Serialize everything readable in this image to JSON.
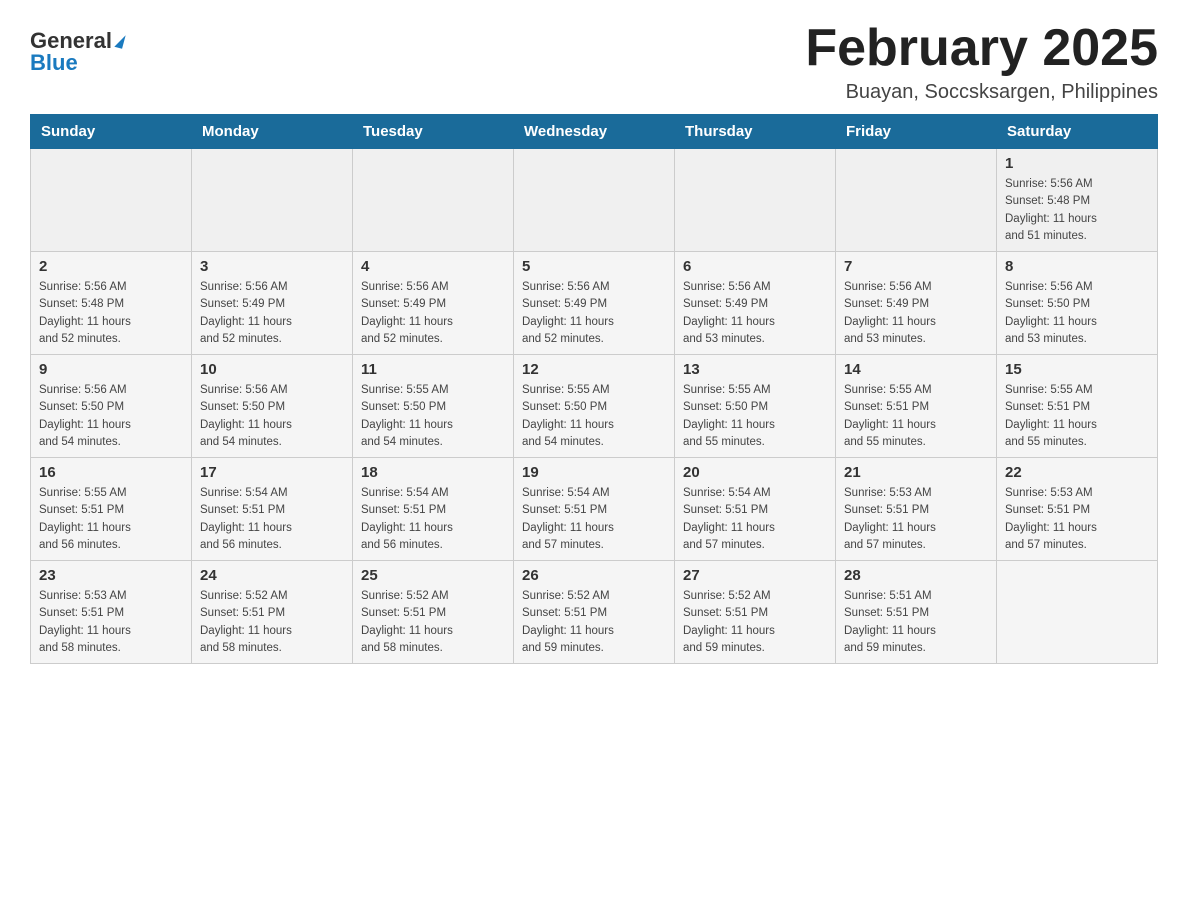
{
  "logo": {
    "general": "General",
    "blue": "Blue",
    "triangle": "▲"
  },
  "title": {
    "month_year": "February 2025",
    "location": "Buayan, Soccsksargen, Philippines"
  },
  "days_of_week": [
    "Sunday",
    "Monday",
    "Tuesday",
    "Wednesday",
    "Thursday",
    "Friday",
    "Saturday"
  ],
  "weeks": [
    {
      "row_class": "top-row",
      "days": [
        {
          "num": "",
          "info": ""
        },
        {
          "num": "",
          "info": ""
        },
        {
          "num": "",
          "info": ""
        },
        {
          "num": "",
          "info": ""
        },
        {
          "num": "",
          "info": ""
        },
        {
          "num": "",
          "info": ""
        },
        {
          "num": "1",
          "info": "Sunrise: 5:56 AM\nSunset: 5:48 PM\nDaylight: 11 hours\nand 51 minutes."
        }
      ]
    },
    {
      "row_class": "row-odd",
      "days": [
        {
          "num": "2",
          "info": "Sunrise: 5:56 AM\nSunset: 5:48 PM\nDaylight: 11 hours\nand 52 minutes."
        },
        {
          "num": "3",
          "info": "Sunrise: 5:56 AM\nSunset: 5:49 PM\nDaylight: 11 hours\nand 52 minutes."
        },
        {
          "num": "4",
          "info": "Sunrise: 5:56 AM\nSunset: 5:49 PM\nDaylight: 11 hours\nand 52 minutes."
        },
        {
          "num": "5",
          "info": "Sunrise: 5:56 AM\nSunset: 5:49 PM\nDaylight: 11 hours\nand 52 minutes."
        },
        {
          "num": "6",
          "info": "Sunrise: 5:56 AM\nSunset: 5:49 PM\nDaylight: 11 hours\nand 53 minutes."
        },
        {
          "num": "7",
          "info": "Sunrise: 5:56 AM\nSunset: 5:49 PM\nDaylight: 11 hours\nand 53 minutes."
        },
        {
          "num": "8",
          "info": "Sunrise: 5:56 AM\nSunset: 5:50 PM\nDaylight: 11 hours\nand 53 minutes."
        }
      ]
    },
    {
      "row_class": "row-even",
      "days": [
        {
          "num": "9",
          "info": "Sunrise: 5:56 AM\nSunset: 5:50 PM\nDaylight: 11 hours\nand 54 minutes."
        },
        {
          "num": "10",
          "info": "Sunrise: 5:56 AM\nSunset: 5:50 PM\nDaylight: 11 hours\nand 54 minutes."
        },
        {
          "num": "11",
          "info": "Sunrise: 5:55 AM\nSunset: 5:50 PM\nDaylight: 11 hours\nand 54 minutes."
        },
        {
          "num": "12",
          "info": "Sunrise: 5:55 AM\nSunset: 5:50 PM\nDaylight: 11 hours\nand 54 minutes."
        },
        {
          "num": "13",
          "info": "Sunrise: 5:55 AM\nSunset: 5:50 PM\nDaylight: 11 hours\nand 55 minutes."
        },
        {
          "num": "14",
          "info": "Sunrise: 5:55 AM\nSunset: 5:51 PM\nDaylight: 11 hours\nand 55 minutes."
        },
        {
          "num": "15",
          "info": "Sunrise: 5:55 AM\nSunset: 5:51 PM\nDaylight: 11 hours\nand 55 minutes."
        }
      ]
    },
    {
      "row_class": "row-odd",
      "days": [
        {
          "num": "16",
          "info": "Sunrise: 5:55 AM\nSunset: 5:51 PM\nDaylight: 11 hours\nand 56 minutes."
        },
        {
          "num": "17",
          "info": "Sunrise: 5:54 AM\nSunset: 5:51 PM\nDaylight: 11 hours\nand 56 minutes."
        },
        {
          "num": "18",
          "info": "Sunrise: 5:54 AM\nSunset: 5:51 PM\nDaylight: 11 hours\nand 56 minutes."
        },
        {
          "num": "19",
          "info": "Sunrise: 5:54 AM\nSunset: 5:51 PM\nDaylight: 11 hours\nand 57 minutes."
        },
        {
          "num": "20",
          "info": "Sunrise: 5:54 AM\nSunset: 5:51 PM\nDaylight: 11 hours\nand 57 minutes."
        },
        {
          "num": "21",
          "info": "Sunrise: 5:53 AM\nSunset: 5:51 PM\nDaylight: 11 hours\nand 57 minutes."
        },
        {
          "num": "22",
          "info": "Sunrise: 5:53 AM\nSunset: 5:51 PM\nDaylight: 11 hours\nand 57 minutes."
        }
      ]
    },
    {
      "row_class": "row-even",
      "days": [
        {
          "num": "23",
          "info": "Sunrise: 5:53 AM\nSunset: 5:51 PM\nDaylight: 11 hours\nand 58 minutes."
        },
        {
          "num": "24",
          "info": "Sunrise: 5:52 AM\nSunset: 5:51 PM\nDaylight: 11 hours\nand 58 minutes."
        },
        {
          "num": "25",
          "info": "Sunrise: 5:52 AM\nSunset: 5:51 PM\nDaylight: 11 hours\nand 58 minutes."
        },
        {
          "num": "26",
          "info": "Sunrise: 5:52 AM\nSunset: 5:51 PM\nDaylight: 11 hours\nand 59 minutes."
        },
        {
          "num": "27",
          "info": "Sunrise: 5:52 AM\nSunset: 5:51 PM\nDaylight: 11 hours\nand 59 minutes."
        },
        {
          "num": "28",
          "info": "Sunrise: 5:51 AM\nSunset: 5:51 PM\nDaylight: 11 hours\nand 59 minutes."
        },
        {
          "num": "",
          "info": ""
        }
      ]
    }
  ]
}
